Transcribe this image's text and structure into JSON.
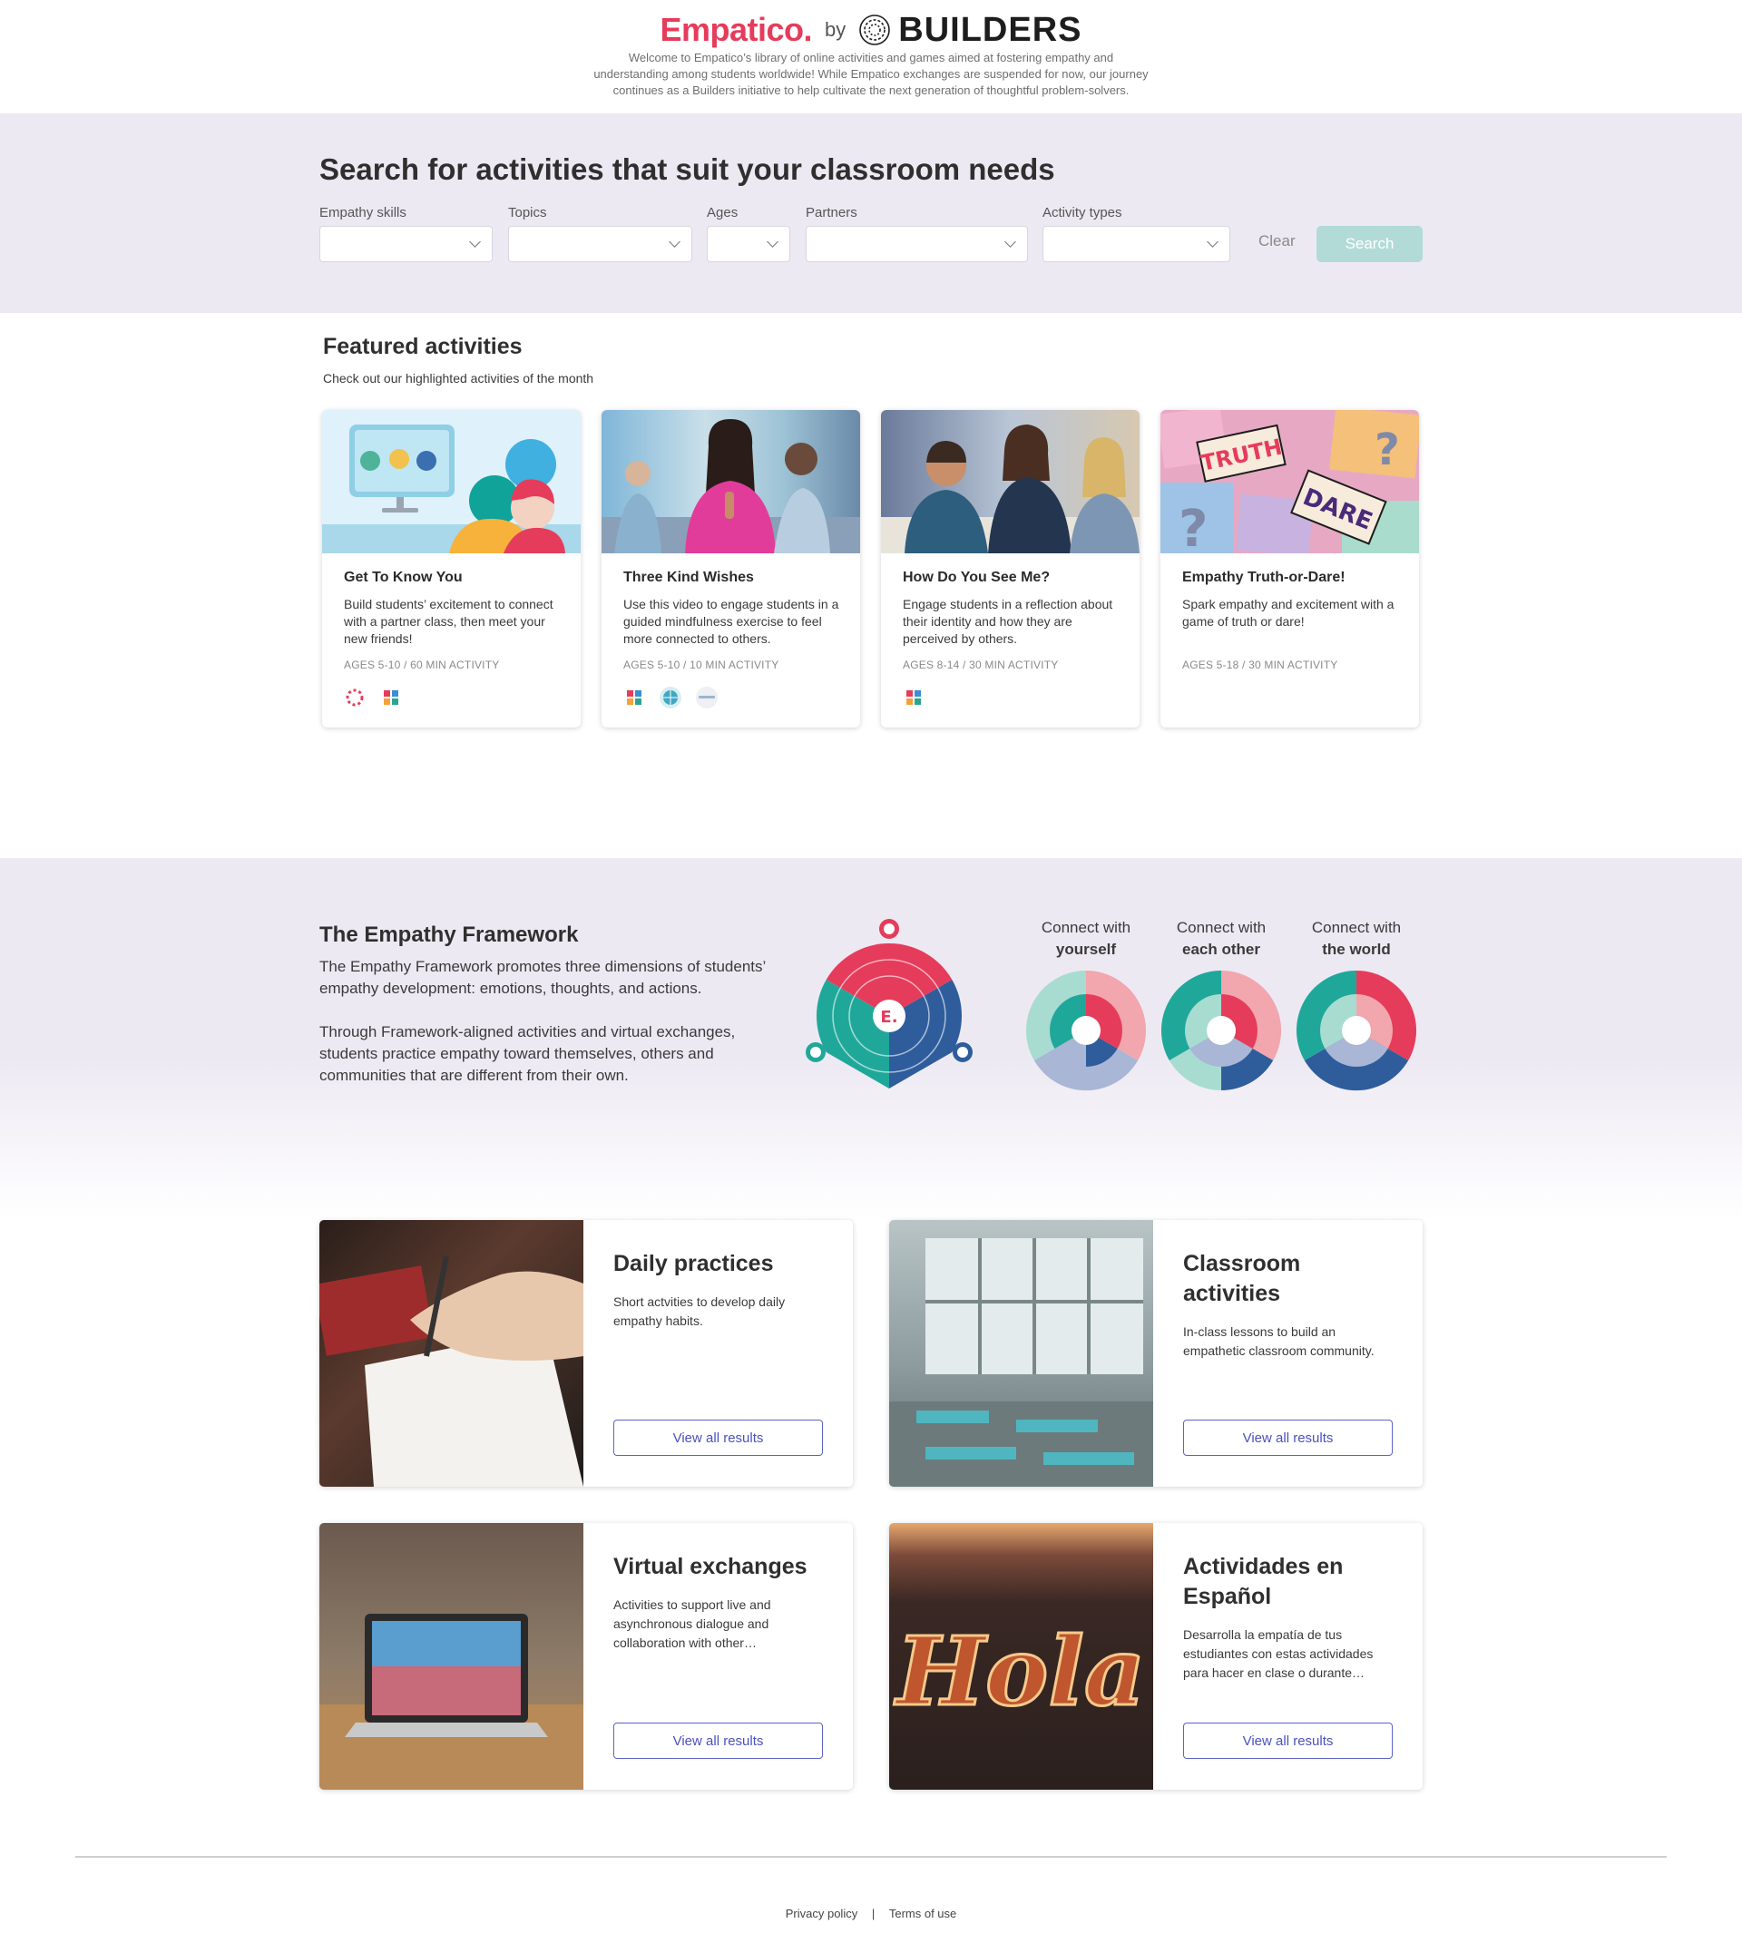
{
  "header": {
    "brand": "Empatico.",
    "by": "by",
    "partner_brand": "BUILDERS",
    "intro": "Welcome to Empatico’s library of online activities and games aimed at fostering empathy and understanding among students worldwide! While Empatico exchanges are suspended for now, our journey continues as a Builders initiative to help cultivate the next generation of thoughtful problem-solvers."
  },
  "search": {
    "title": "Search for activities that suit your classroom needs",
    "filters": [
      {
        "label": "Empathy skills",
        "value": ""
      },
      {
        "label": "Topics",
        "value": ""
      },
      {
        "label": "Ages",
        "value": ""
      },
      {
        "label": "Partners",
        "value": ""
      },
      {
        "label": "Activity types",
        "value": ""
      }
    ],
    "clear_label": "Clear",
    "search_label": "Search"
  },
  "featured": {
    "title": "Featured activities",
    "subtitle": "Check out our highlighted activities of the month",
    "cards": [
      {
        "title": "Get To Know You",
        "desc": "Build students’ excitement to connect with a partner class, then meet your new friends!",
        "meta": "AGES 5-10 / 60 MIN ACTIVITY"
      },
      {
        "title": "Three Kind Wishes",
        "desc": "Use this video to engage students in a guided mindfulness exercise to feel more connected to others.",
        "meta": "AGES 5-10 / 10 MIN ACTIVITY"
      },
      {
        "title": "How Do You See Me?",
        "desc": "Engage students in a reflection about their identity and how they are perceived by others.",
        "meta": "AGES 8-14 / 30 MIN ACTIVITY"
      },
      {
        "title": "Empathy Truth-or-Dare!",
        "desc": "Spark empathy and excitement with a game of truth or dare!",
        "meta": "AGES 5-18 / 30 MIN ACTIVITY",
        "img_words": [
          "TRUTH",
          "DARE"
        ]
      }
    ]
  },
  "framework": {
    "title": "The Empathy Framework",
    "para1": "The Empathy Framework promotes three dimensions of students’ empathy development: emotions, thoughts, and actions.",
    "para2": "Through Framework-aligned activities and virtual exchanges, students practice empathy toward themselves, others and communities that are different from their own.",
    "wheel_center": "E.",
    "connect": [
      {
        "line1": "Connect with",
        "line2": "yourself"
      },
      {
        "line1": "Connect with",
        "line2": "each other"
      },
      {
        "line1": "Connect with",
        "line2": "the world"
      }
    ]
  },
  "tiles": [
    {
      "title": "Daily practices",
      "desc": "Short actvities to develop daily empathy habits.",
      "button": "View all results"
    },
    {
      "title": "Classroom activities",
      "desc": "In-class lessons to build an empathetic classroom community.",
      "button": "View all results"
    },
    {
      "title": "Virtual exchanges",
      "desc": "Activities to support live and asynchronous dialogue and collaboration with other…",
      "button": "View all results"
    },
    {
      "title": "Actividades en Español",
      "desc": "Desarrolla la empatía de tus estudiantes con estas actividades para hacer en clase o durante…",
      "button": "View all results",
      "img_word": "Hola"
    }
  ],
  "footer": {
    "privacy": "Privacy policy",
    "separator": "|",
    "terms": "Terms of use"
  },
  "colors": {
    "brand_red": "#e63c5b",
    "lavender_band": "#ede9f3",
    "search_button": "#b2dbd8",
    "link_blue": "#4a51c0",
    "teal": "#1fa89a",
    "navy": "#2f5d9c"
  }
}
